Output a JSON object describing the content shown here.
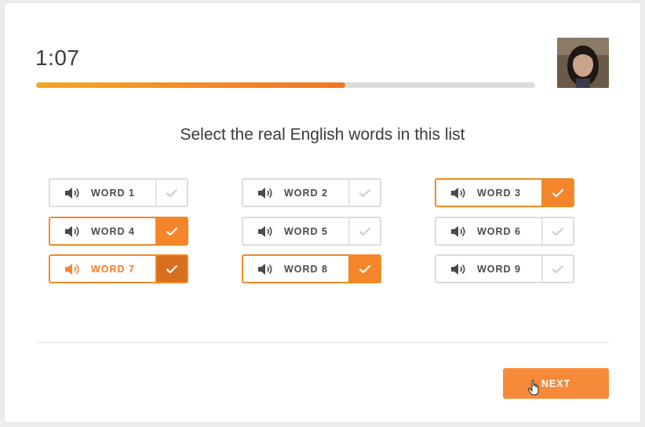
{
  "timer": "1:07",
  "progress": {
    "fraction": 0.62
  },
  "prompt": "Select the real English words in this list",
  "words": [
    {
      "label": "WORD 1",
      "selected": false
    },
    {
      "label": "WORD 2",
      "selected": false
    },
    {
      "label": "WORD 3",
      "selected": true
    },
    {
      "label": "WORD 4",
      "selected": true
    },
    {
      "label": "WORD 5",
      "selected": false
    },
    {
      "label": "WORD 6",
      "selected": false
    },
    {
      "label": "WORD 7",
      "selected": true,
      "active": true
    },
    {
      "label": "WORD 8",
      "selected": true
    },
    {
      "label": "WORD 9",
      "selected": false
    }
  ],
  "next_label": "NEXT",
  "colors": {
    "accent": "#f5852a",
    "accent_dark": "#d86e1e",
    "border": "#dcdcdc",
    "check_inactive": "#cfcfcf"
  },
  "icons": {
    "speaker": "speaker-icon",
    "check": "check-icon",
    "cursor": "hand-cursor-icon"
  }
}
